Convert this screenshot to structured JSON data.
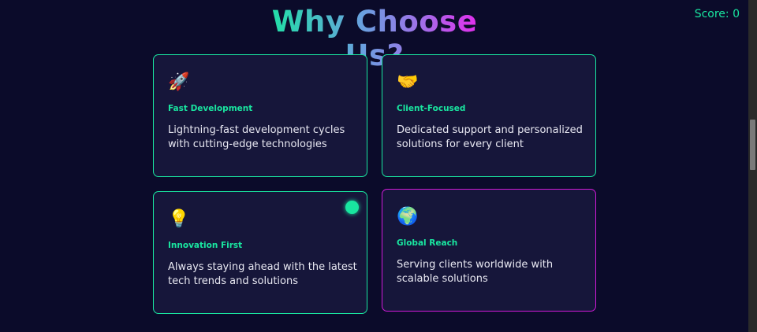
{
  "section": {
    "title": "Why Choose Us?"
  },
  "score": {
    "label": "Score: 0"
  },
  "cards": [
    {
      "icon": "🚀",
      "icon_name": "rocket-icon",
      "title": "Fast Development",
      "description": "Lightning-fast development cycles with cutting-edge technologies"
    },
    {
      "icon": "🤝",
      "icon_name": "handshake-icon",
      "title": "Client-Focused",
      "description": "Dedicated support and personalized solutions for every client"
    },
    {
      "icon": "💡",
      "icon_name": "lightbulb-icon",
      "title": "Innovation First",
      "description": "Always staying ahead with the latest tech trends and solutions"
    },
    {
      "icon": "🌍",
      "icon_name": "globe-icon",
      "title": "Global Reach",
      "description": "Serving clients worldwide with scalable solutions"
    }
  ],
  "colors": {
    "background": "#0b0b2a",
    "card_background": "#16163a",
    "accent_green": "#19e6a0",
    "accent_pink": "#d01ad8",
    "text": "#e8e8f2"
  }
}
